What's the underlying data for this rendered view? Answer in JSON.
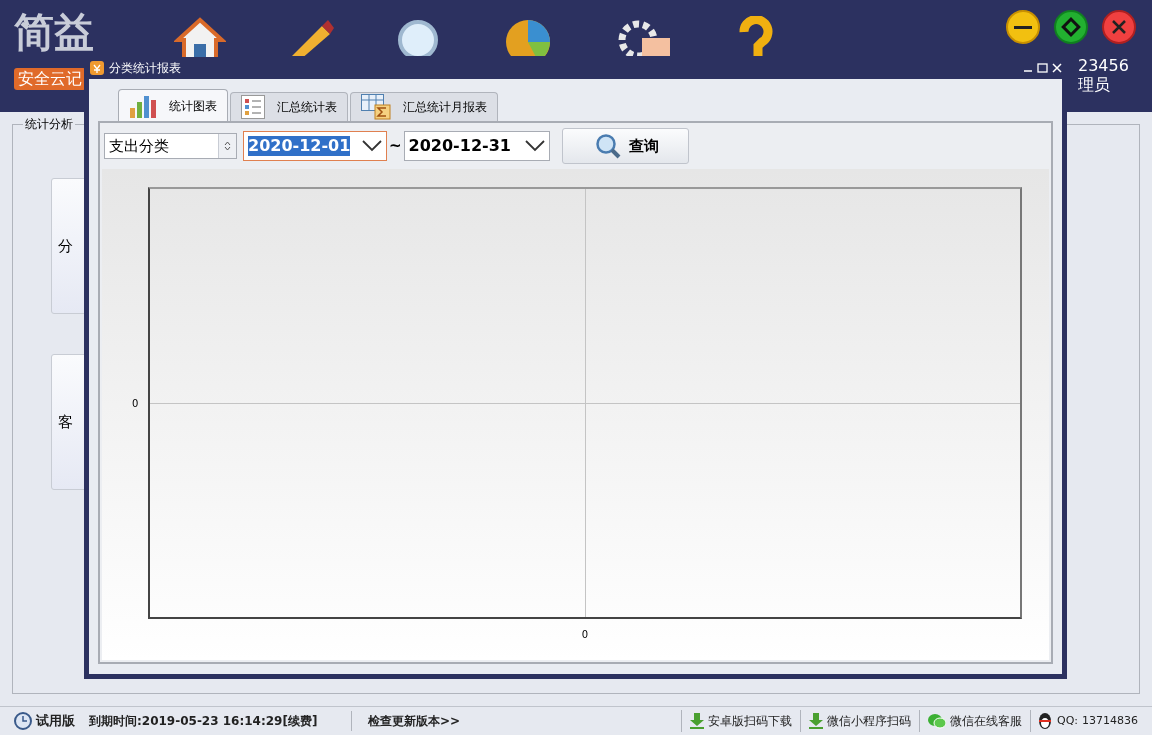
{
  "app": {
    "logo": "简益",
    "badge": "安全云记",
    "user_id": "23456",
    "user_role": "理员"
  },
  "group": {
    "title": "统计分析",
    "buttons": [
      "分",
      "客"
    ]
  },
  "dialog": {
    "title": "分类统计报表",
    "tabs": [
      {
        "label": "统计图表",
        "kind": "bars",
        "selected": true
      },
      {
        "label": "汇总统计表",
        "kind": "list",
        "selected": false
      },
      {
        "label": "汇总统计月报表",
        "kind": "sum",
        "selected": false
      }
    ],
    "category": {
      "value": "支出分类"
    },
    "date_from": {
      "value": "2020-12-01",
      "selected": true
    },
    "separator": "~",
    "date_to": {
      "value": "2020-12-31",
      "selected": false
    },
    "query_button": "查询",
    "chart": {
      "y_tick": "0",
      "x_tick": "0"
    }
  },
  "status_bar": {
    "edition": "试用版",
    "expiry": "到期时间:2019-05-23 16:14:29[续费]",
    "update": "检查更新版本>>",
    "links": [
      {
        "label": "安卓版扫码下载",
        "kind": "download"
      },
      {
        "label": "微信小程序扫码",
        "kind": "download"
      },
      {
        "label": "微信在线客服",
        "kind": "chat"
      }
    ],
    "qq_label": "QQ:",
    "qq": "13714836"
  }
}
